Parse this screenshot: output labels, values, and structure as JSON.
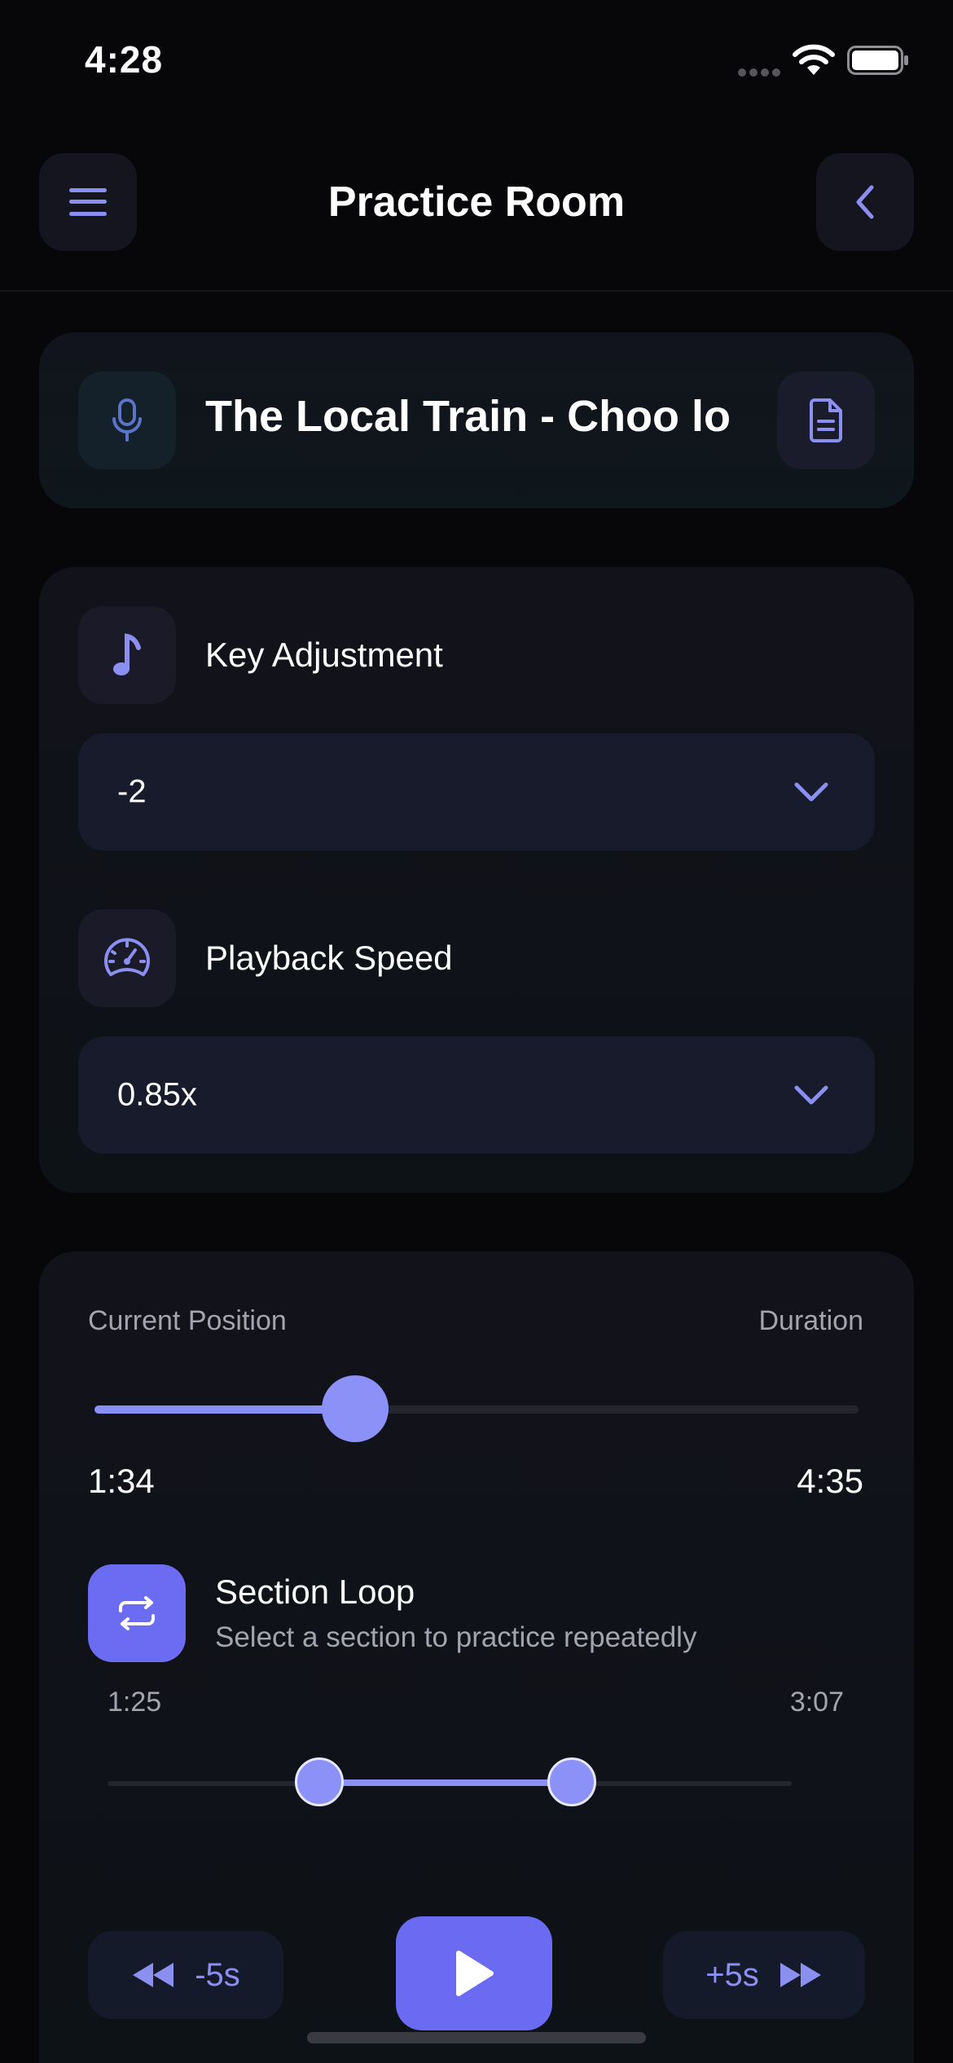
{
  "status_bar": {
    "time": "4:28"
  },
  "header": {
    "title": "Practice Room"
  },
  "song": {
    "title": "The Local Train - Choo lo"
  },
  "key_adjustment": {
    "label": "Key Adjustment",
    "value": "-2"
  },
  "playback_speed": {
    "label": "Playback Speed",
    "value": "0.85x"
  },
  "position": {
    "current_label": "Current Position",
    "duration_label": "Duration",
    "current": "1:34",
    "duration": "4:35",
    "progress_fraction": 0.341
  },
  "section_loop": {
    "title": "Section Loop",
    "subtitle": "Select a section to practice repeatedly",
    "start": "1:25",
    "end": "3:07",
    "start_fraction": 0.309,
    "end_fraction": 0.679
  },
  "controls": {
    "rewind_label": "-5s",
    "forward_label": "+5s"
  },
  "colors": {
    "accent": "#6a6af2",
    "accent_light": "#8a90f6",
    "background": "#070709"
  }
}
